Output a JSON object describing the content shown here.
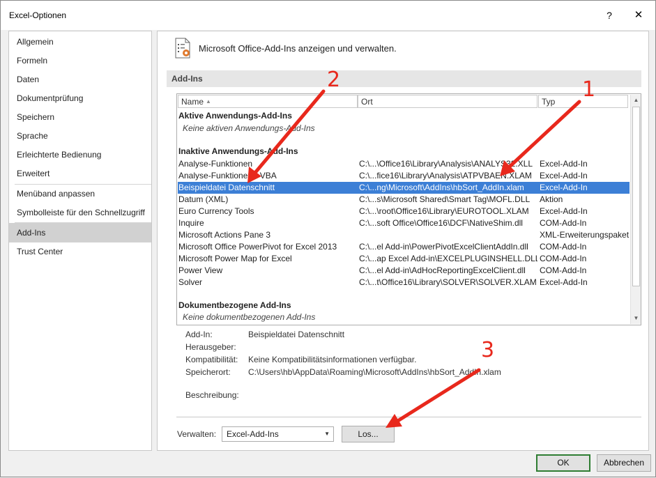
{
  "window": {
    "title": "Excel-Optionen",
    "help_label": "?",
    "close_label": "✕"
  },
  "sidebar": {
    "items": [
      {
        "label": "Allgemein"
      },
      {
        "label": "Formeln"
      },
      {
        "label": "Daten"
      },
      {
        "label": "Dokumentprüfung"
      },
      {
        "label": "Speichern"
      },
      {
        "label": "Sprache"
      },
      {
        "label": "Erleichterte Bedienung"
      },
      {
        "label": "Erweitert"
      },
      {
        "label": "Menüband anpassen"
      },
      {
        "label": "Symbolleiste für den Schnellzugriff"
      },
      {
        "label": "Add-Ins",
        "selected": true
      },
      {
        "label": "Trust Center"
      }
    ]
  },
  "header": {
    "title": "Microsoft Office-Add-Ins anzeigen und verwalten.",
    "icon": "addins-gear-icon"
  },
  "section": {
    "title": "Add-Ins"
  },
  "list": {
    "columns": {
      "name": "Name",
      "location": "Ort",
      "type": "Typ"
    },
    "groups": {
      "active": {
        "title": "Aktive Anwendungs-Add-Ins",
        "empty": "Keine aktiven Anwendungs-Add-Ins"
      },
      "inactive": {
        "title": "Inaktive Anwendungs-Add-Ins"
      },
      "document": {
        "title": "Dokumentbezogene Add-Ins",
        "empty": "Keine dokumentbezogenen Add-Ins"
      }
    },
    "rows": [
      {
        "name": "Analyse-Funktionen",
        "location": "C:\\...\\Office16\\Library\\Analysis\\ANALYS32.XLL",
        "type": "Excel-Add-In"
      },
      {
        "name": "Analyse-Funktionen - VBA",
        "location": "C:\\...fice16\\Library\\Analysis\\ATPVBAEN.XLAM",
        "type": "Excel-Add-In"
      },
      {
        "name": "Beispieldatei Datenschnitt",
        "location": "C:\\...ng\\Microsoft\\AddIns\\hbSort_AddIn.xlam",
        "type": "Excel-Add-In",
        "selected": true
      },
      {
        "name": "Datum (XML)",
        "location": "C:\\...s\\Microsoft Shared\\Smart Tag\\MOFL.DLL",
        "type": "Aktion"
      },
      {
        "name": "Euro Currency Tools",
        "location": "C:\\...\\root\\Office16\\Library\\EUROTOOL.XLAM",
        "type": "Excel-Add-In"
      },
      {
        "name": "Inquire",
        "location": "C:\\...soft Office\\Office16\\DCF\\NativeShim.dll",
        "type": "COM-Add-In"
      },
      {
        "name": "Microsoft Actions Pane 3",
        "location": "",
        "type": "XML-Erweiterungspaket"
      },
      {
        "name": "Microsoft Office PowerPivot for Excel 2013",
        "location": "C:\\...el Add-in\\PowerPivotExcelClientAddIn.dll",
        "type": "COM-Add-In"
      },
      {
        "name": "Microsoft Power Map for Excel",
        "location": "C:\\...ap Excel Add-in\\EXCELPLUGINSHELL.DLL",
        "type": "COM-Add-In"
      },
      {
        "name": "Power View",
        "location": "C:\\...el Add-in\\AdHocReportingExcelClient.dll",
        "type": "COM-Add-In"
      },
      {
        "name": "Solver",
        "location": "C:\\...t\\Office16\\Library\\SOLVER\\SOLVER.XLAM",
        "type": "Excel-Add-In"
      }
    ]
  },
  "details": {
    "addin_label": "Add-In:",
    "addin_value": "Beispieldatei Datenschnitt",
    "publisher_label": "Herausgeber:",
    "publisher_value": "",
    "compat_label": "Kompatibilität:",
    "compat_value": "Keine Kompatibilitätsinformationen verfügbar.",
    "location_label": "Speicherort:",
    "location_value": "C:\\Users\\hb\\AppData\\Roaming\\Microsoft\\AddIns\\hbSort_AddIn.xlam",
    "description_label": "Beschreibung:",
    "description_value": ""
  },
  "manage": {
    "label": "Verwalten:",
    "selected": "Excel-Add-Ins",
    "go_label": "Los..."
  },
  "footer": {
    "ok_label": "OK",
    "cancel_label": "Abbrechen"
  },
  "annotations": {
    "num1": "1",
    "num2": "2",
    "num3": "3",
    "color": "#e8281c"
  }
}
